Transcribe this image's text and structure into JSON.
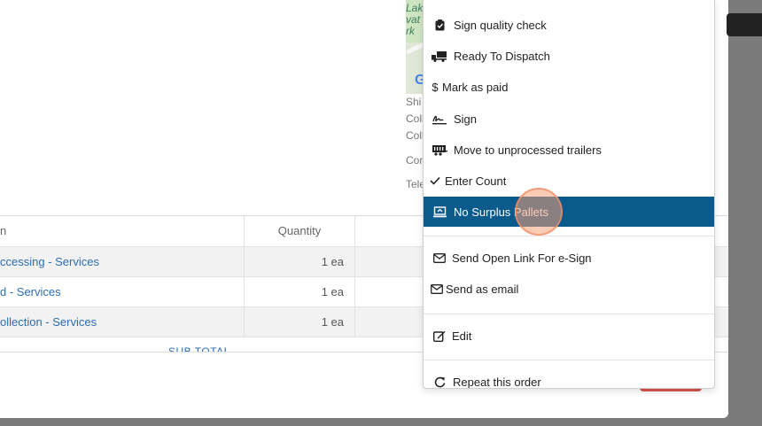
{
  "table": {
    "headers": {
      "name": "n",
      "quantity": "Quantity"
    },
    "rows": [
      {
        "name": "ccessing - Services",
        "quantity": "1 ea"
      },
      {
        "name": "d - Services",
        "quantity": "1 ea"
      },
      {
        "name": "ollection - Services",
        "quantity": "1 ea"
      }
    ],
    "subtotal_label": "SUB TOTAL"
  },
  "map": {
    "labels": [
      "Lak",
      "vat",
      "rk"
    ],
    "google_letter": "G"
  },
  "address": {
    "lines": [
      "Shi",
      "Coll",
      "Coll",
      "Con",
      "Tele"
    ]
  },
  "menu": {
    "items": [
      {
        "label": "Sign quality check",
        "icon": "clipboard-check-icon"
      },
      {
        "label": "Ready To Dispatch",
        "icon": "truck-loading-icon"
      },
      {
        "label": "Mark as paid",
        "icon": "dollar-icon"
      },
      {
        "label": "Sign",
        "icon": "signature-icon"
      },
      {
        "label": "Move to unprocessed trailers",
        "icon": "trailer-icon"
      },
      {
        "label": "Enter Count",
        "icon": "check-icon"
      },
      {
        "label": "No Surplus Pallets",
        "icon": "pallet-icon"
      },
      {
        "label": "Send Open Link For e-Sign",
        "icon": "envelope-icon"
      },
      {
        "label": "Send as email",
        "icon": "envelope-icon"
      },
      {
        "label": "Edit",
        "icon": "edit-icon"
      },
      {
        "label": "Repeat this order",
        "icon": "redo-icon"
      }
    ],
    "active_index": 6,
    "accent_color": "#0a5a8c"
  }
}
